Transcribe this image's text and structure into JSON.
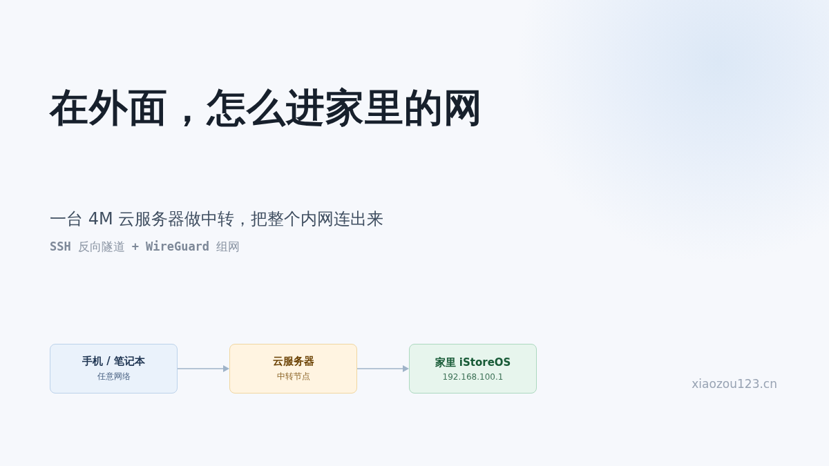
{
  "title": "在外面，怎么进家里的网",
  "subtitle": "一台 4M 云服务器做中转，把整个内网连出来",
  "tech_line": [
    {
      "text": "SSH",
      "kind": "code"
    },
    {
      "text": "反向隧道",
      "kind": "plain"
    },
    {
      "text": "+",
      "kind": "code"
    },
    {
      "text": "WireGuard",
      "kind": "code"
    },
    {
      "text": "组网",
      "kind": "plain"
    }
  ],
  "diagram": [
    {
      "title": "手机 / 笔记本",
      "caption": "任意网络",
      "kind": "device"
    },
    {
      "title": "云服务器",
      "caption": "中转节点",
      "kind": "server"
    },
    {
      "title": "家里 iStoreOS",
      "caption": "192.168.100.1",
      "kind": "home"
    }
  ],
  "site": "xiaozou123.cn"
}
